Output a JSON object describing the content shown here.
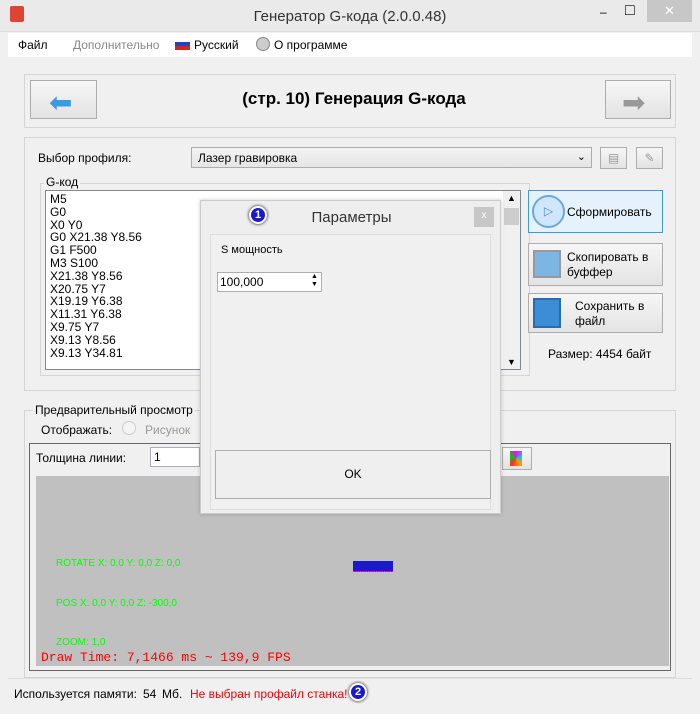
{
  "window": {
    "title": "Генератор G-кода (2.0.0.48)",
    "minimize": "‒",
    "maximize": "□",
    "close": "✕"
  },
  "menu": {
    "file": "Файл",
    "extra": "Дополнительно",
    "language": "Русский",
    "about": "О программе"
  },
  "header": {
    "title": "(стр. 10) Генерация G-кода"
  },
  "profile": {
    "label": "Выбор профиля:",
    "value": "Лазер гравировка"
  },
  "gcode": {
    "label": "G-код",
    "lines": [
      "M5",
      "G0",
      "X0 Y0",
      "G0 X21.38  Y8.56",
      "G1 F500",
      "M3 S100",
      "X21.38  Y8.56",
      "X20.75  Y7",
      "X19.19  Y6.38",
      "X11.31  Y6.38",
      "X9.75  Y7",
      "X9.13  Y8.56",
      "X9.13  Y34.81"
    ]
  },
  "actions": {
    "generate": "Сформировать",
    "copy": "Скопировать в буффер",
    "save": "Сохранить в файл",
    "size": "Размер: 4454 байт"
  },
  "preview": {
    "label": "Предварительный просмотр",
    "display_label": "Отображать:",
    "radio_picture": "Рисунок",
    "line_width_label": "Толщина линии:",
    "line_width": "1",
    "rotate": "ROTATE X: 0,0  Y: 0,0 Z: 0,0",
    "pos": "POS X: 0,0  Y: 0,0 Z: -300,0",
    "zoom": "ZOOM: 1,0",
    "draw_time": "Draw Time: 7,1466 ms ~ 139,9 FPS"
  },
  "status": {
    "memory_label": "Используется памяти:",
    "memory_value": "54",
    "memory_unit": "Мб.",
    "warning": "Не выбран профайл станка!",
    "badge": "2"
  },
  "dialog": {
    "title": "Параметры",
    "badge": "1",
    "close": "x",
    "field_label": "S мощность",
    "field_value": "100,000",
    "ok": "OK"
  }
}
